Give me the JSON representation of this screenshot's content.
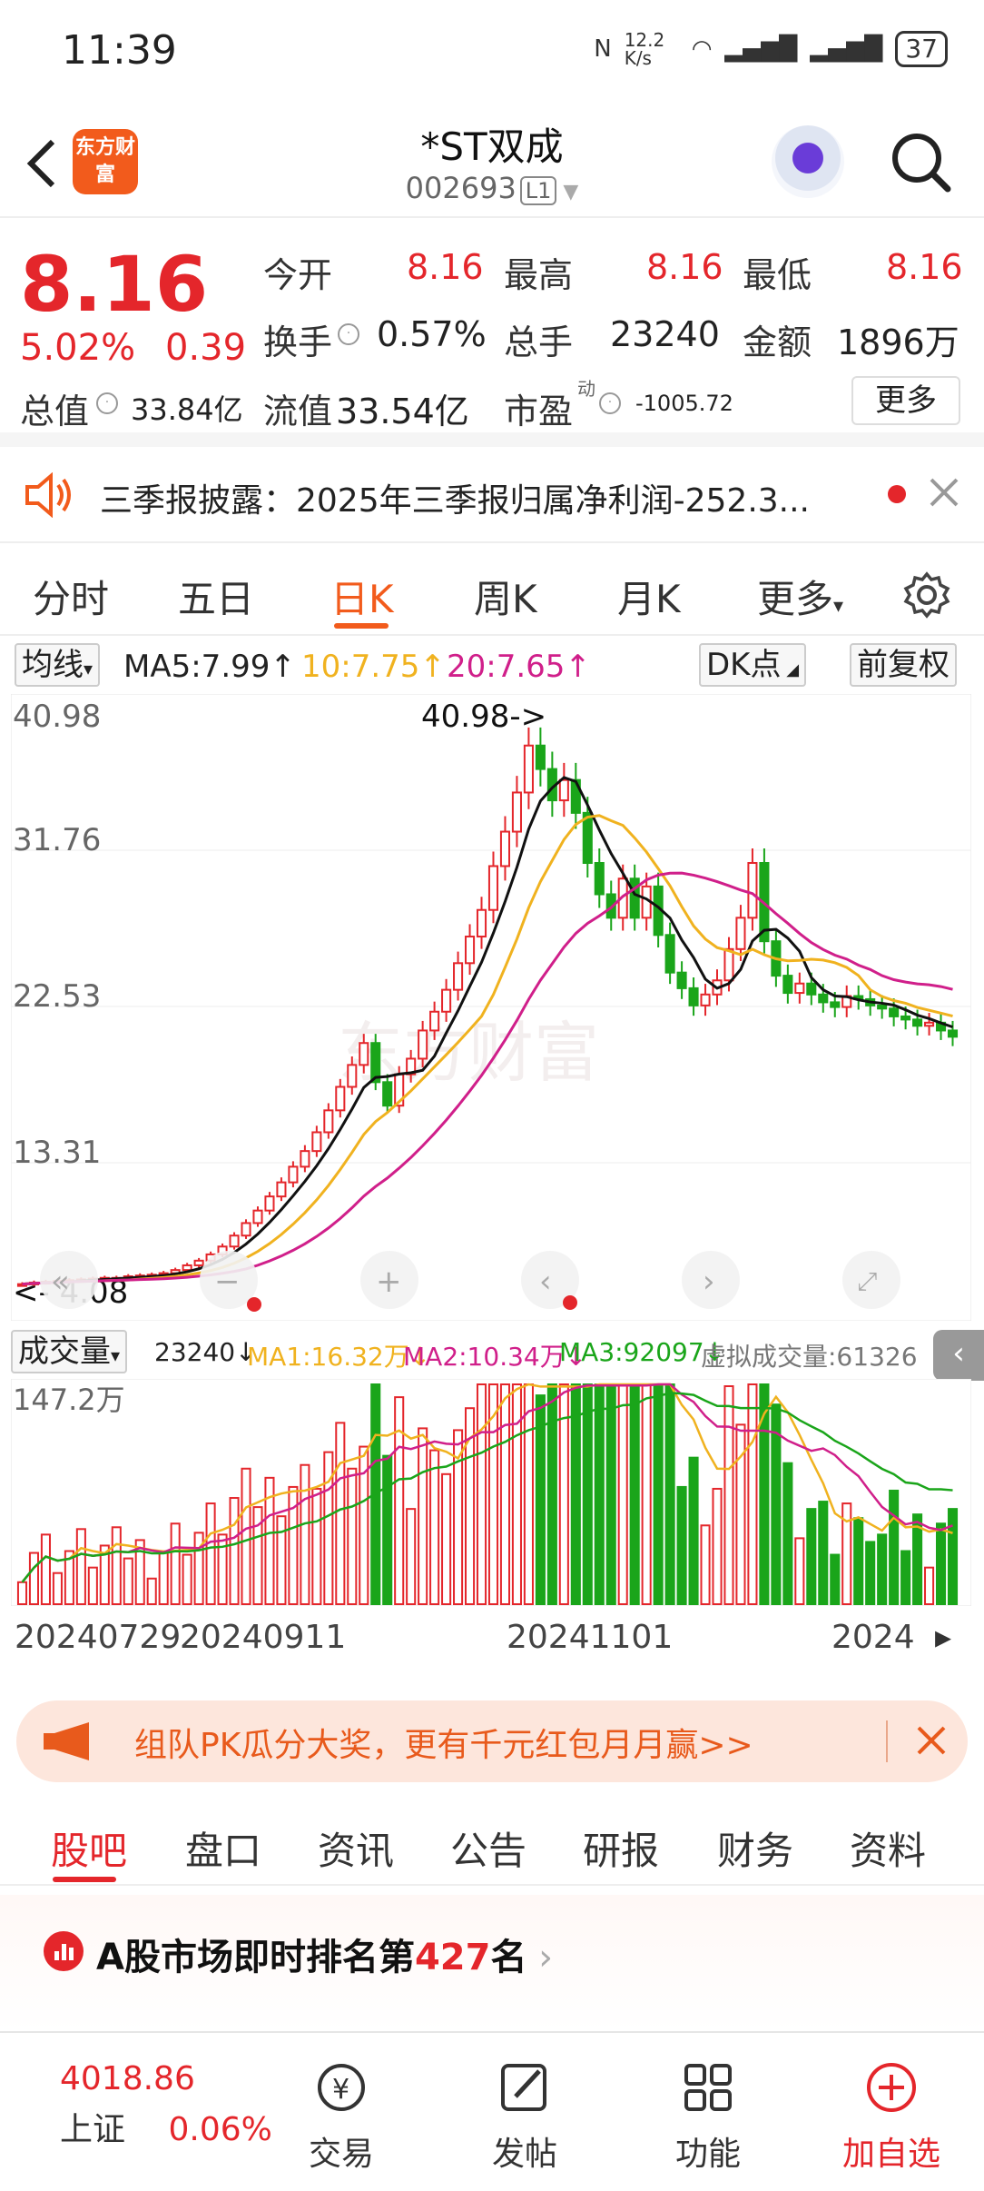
{
  "status_bar": {
    "time": "11:39",
    "net_speed": "12.2 K/s",
    "battery": "37"
  },
  "header": {
    "title": "*ST双成",
    "code": "002693",
    "level": "L1",
    "logo_text": "东方财富"
  },
  "quote": {
    "price": "8.16",
    "change_pct": "5.02%",
    "change": "0.39",
    "open_label": "今开",
    "open": "8.16",
    "high_label": "最高",
    "high": "8.16",
    "low_label": "最低",
    "low": "8.16",
    "turnover_label": "换手",
    "turnover": "0.57%",
    "volume_label": "总手",
    "volume": "23240",
    "amount_label": "金额",
    "amount": "1896万",
    "mktcap_label": "总值",
    "mktcap": "33.84亿",
    "float_label": "流值",
    "float": "33.54亿",
    "pe_label": "市盈",
    "pe_sup": "动",
    "pe": "-1005.72",
    "more": "更多"
  },
  "notice": {
    "text": "三季报披露：2025年三季报归属净利润-252.3..."
  },
  "ktabs": [
    "分时",
    "五日",
    "日K",
    "周K",
    "月K",
    "更多"
  ],
  "ma_bar": {
    "selector": "均线",
    "ma5": "MA5:7.99",
    "ma10": "10:7.75",
    "ma20": "20:7.65",
    "dk": "DK点",
    "adjust": "前复权"
  },
  "chart_axis": {
    "y1": "40.98",
    "y2": "31.76",
    "y3": "22.53",
    "y4": "13.31",
    "y5": "4.08",
    "max_marker": "40.98->",
    "min_marker": "<- 4.08"
  },
  "volume_bar": {
    "selector": "成交量",
    "vol": "23240",
    "ma1": "MA1:16.32万",
    "ma2": "MA2:10.34万",
    "ma3": "MA3:92097",
    "virtual": "虚拟成交量:61326",
    "ymax": "147.2万"
  },
  "dates": [
    "20240729",
    "20240911",
    "20241101",
    "2024"
  ],
  "promo": {
    "text": "组队PK瓜分大奖，更有千元红包月月赢>>"
  },
  "btabs": [
    "股吧",
    "盘口",
    "资讯",
    "公告",
    "研报",
    "财务",
    "资料"
  ],
  "rank": {
    "prefix": "A股市场即时排名第",
    "number": "427",
    "suffix": "名"
  },
  "bottom_nav": {
    "index_value": "4018.86",
    "index_name": "上证",
    "index_change": "0.06%",
    "trade": "交易",
    "post": "发帖",
    "func": "功能",
    "watch": "加自选"
  },
  "colors": {
    "up": "#e4262b",
    "down": "#1aa51a",
    "accent": "#f25b1c",
    "ma5": "#111111",
    "ma10": "#f0b21f",
    "ma20": "#d01f8a"
  },
  "chart_data": {
    "type": "candlestick",
    "ylim": [
      4.08,
      40.98
    ],
    "closes": [
      4.1,
      4.2,
      4.25,
      4.3,
      4.35,
      4.4,
      4.45,
      4.5,
      4.5,
      4.6,
      4.65,
      4.7,
      4.8,
      5.0,
      5.3,
      5.6,
      6.0,
      6.5,
      7.2,
      8.0,
      8.8,
      9.7,
      10.6,
      11.6,
      12.6,
      13.8,
      15.2,
      16.7,
      18.1,
      19.5,
      17.0,
      15.5,
      17.5,
      18.5,
      20.3,
      21.5,
      22.9,
      24.6,
      26.3,
      28.0,
      30.8,
      33.0,
      35.5,
      38.5,
      37.0,
      35.0,
      36.3,
      34.2,
      31.0,
      29.0,
      27.5,
      30.0,
      27.5,
      29.5,
      26.4,
      24.0,
      23.0,
      21.9,
      22.6,
      23.5,
      25.5,
      27.5,
      31.0,
      26.0,
      23.8,
      22.7,
      23.3,
      22.6,
      22.1,
      21.8,
      22.5,
      22.3,
      21.9,
      21.7,
      21.2,
      21.0,
      20.6,
      20.8,
      20.3,
      19.9
    ],
    "volume_max": "147.2万"
  }
}
